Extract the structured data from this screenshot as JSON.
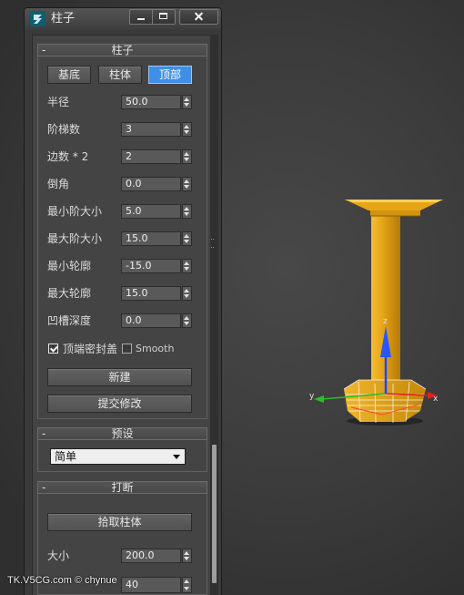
{
  "window": {
    "title": "柱子",
    "icons": {
      "app": "3ds-max-logo-icon",
      "minimize": "minimize-icon",
      "maximize": "maximize-icon",
      "close": "close-icon"
    }
  },
  "rollouts": {
    "column": {
      "toggle": "-",
      "title": "柱子",
      "tabs": [
        {
          "label": "基底",
          "selected": false
        },
        {
          "label": "柱体",
          "selected": false
        },
        {
          "label": "顶部",
          "selected": true
        }
      ],
      "params": [
        {
          "label": "半径",
          "value": "50.0"
        },
        {
          "label": "阶梯数",
          "value": "3"
        },
        {
          "label": "边数 * 2",
          "value": "2"
        },
        {
          "label": "倒角",
          "value": "0.0"
        },
        {
          "label": "最小阶大小",
          "value": "5.0"
        },
        {
          "label": "最大阶大小",
          "value": "15.0"
        },
        {
          "label": "最小轮廓",
          "value": "-15.0"
        },
        {
          "label": "最大轮廓",
          "value": "15.0"
        },
        {
          "label": "凹槽深度",
          "value": "0.0"
        }
      ],
      "checkboxes": [
        {
          "label": "顶端密封盖",
          "checked": true
        },
        {
          "label": "Smooth",
          "checked": false
        }
      ],
      "buttons": {
        "create": "新建",
        "apply": "提交修改"
      }
    },
    "presets": {
      "toggle": "-",
      "title": "预设",
      "dropdown": {
        "selected": "简单",
        "icon": "chevron-down-icon"
      }
    },
    "break": {
      "toggle": "-",
      "title": "打断",
      "pick_button": "拾取柱体",
      "params": [
        {
          "label": "大小",
          "value": "200.0"
        },
        {
          "value": "40"
        }
      ]
    }
  },
  "viewport": {
    "gizmo_axes": {
      "x": "x",
      "y": "y",
      "z": "z"
    }
  },
  "watermark": "TK.V5CG.com © chynue",
  "colors": {
    "panel_bg": "#444444",
    "selected_tab": "#3f8fe6",
    "column_orange": "#e6a516",
    "axis_x": "#e02020",
    "axis_y": "#28c028",
    "axis_z": "#2a55ff"
  }
}
